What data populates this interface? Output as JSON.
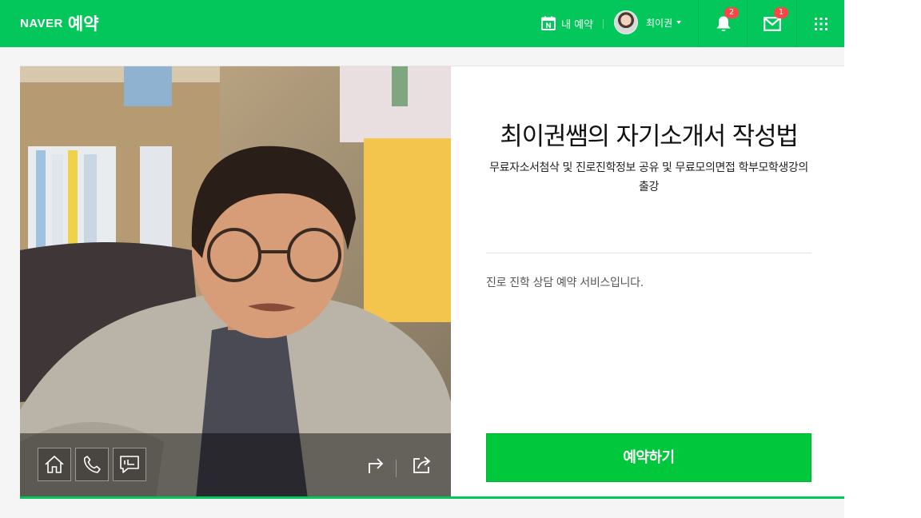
{
  "header": {
    "logo_naver": "NAVER",
    "logo_service": "예약",
    "my_reservations_label": "내 예약",
    "user_name": "최이권",
    "notifications_count": "2",
    "messages_count": "1",
    "icons": {
      "calendar": "calendar-icon",
      "bell": "bell-icon",
      "mail": "mail-icon",
      "apps": "grid-icon"
    }
  },
  "business": {
    "title": "최이권쌤의 자기소개서 작성법",
    "subtitle": "무료자소서첨삭 및 진로진학정보 공유 및 무료모의면접 학부모학생강의 출강",
    "description": "진로 진학 상담 예약 서비스입니다.",
    "book_button": "예약하기"
  },
  "photo_toolbar": {
    "buttons": [
      "home-icon",
      "phone-icon",
      "talk-icon"
    ],
    "right_icons": [
      "directions-icon",
      "share-icon"
    ]
  },
  "colors": {
    "brand_green": "#03c75a",
    "book_green": "#00c73c",
    "badge_red": "#ff4545"
  }
}
